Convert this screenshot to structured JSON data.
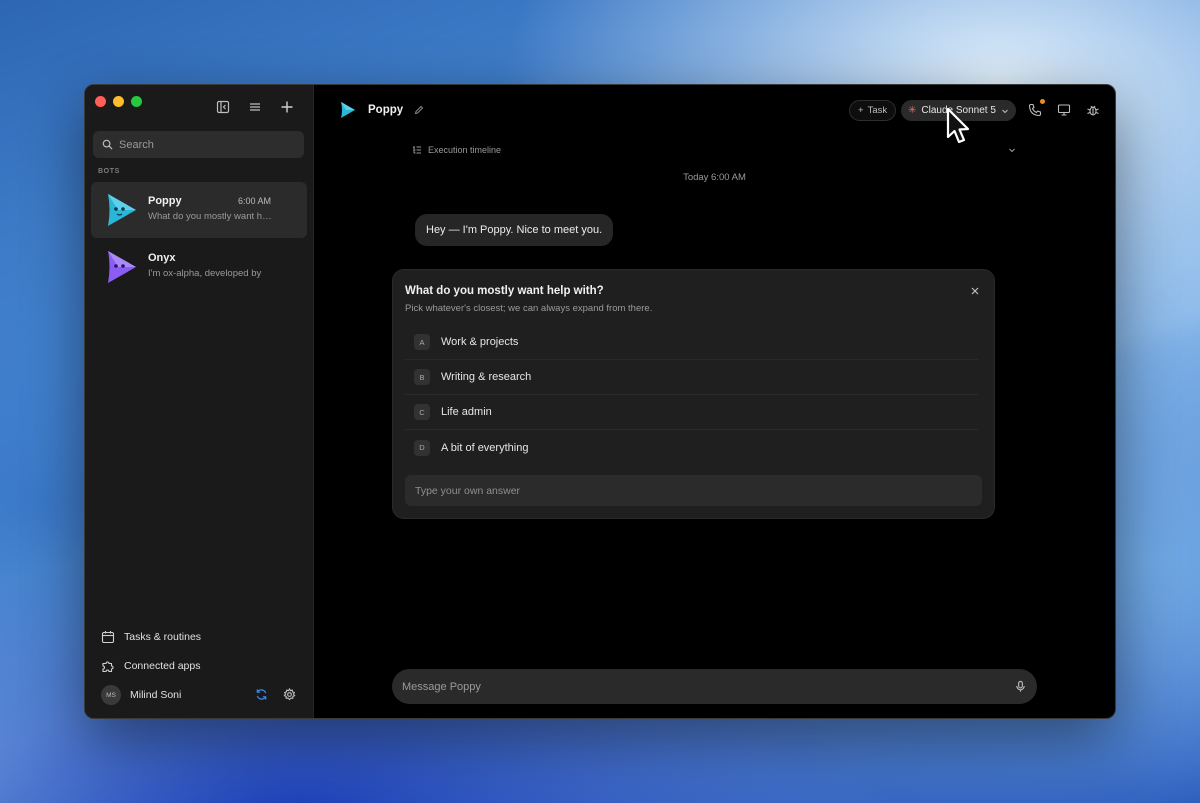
{
  "window": {
    "traffic_lights": [
      "close",
      "minimize",
      "zoom"
    ]
  },
  "sidebar": {
    "search_placeholder": "Search",
    "section_label": "BOTS",
    "bots": [
      {
        "name": "Poppy",
        "time": "6:00 AM",
        "preview": "What do you mostly want help with?",
        "active": true,
        "color": "#2bb5d6"
      },
      {
        "name": "Onyx",
        "time": "",
        "preview": "I'm ox-alpha, developed by",
        "active": false,
        "color": "#8b5cf6"
      }
    ],
    "links": [
      {
        "label": "Tasks & routines",
        "icon": "calendar-icon"
      },
      {
        "label": "Connected apps",
        "icon": "puzzle-icon"
      }
    ],
    "user": {
      "initials": "MS",
      "name": "Milind Soni"
    }
  },
  "header": {
    "title": "Poppy",
    "task_label": "Task",
    "model_label": "Claude Sonnet 5",
    "accent": "#d97757"
  },
  "chat": {
    "timeline_label": "Execution timeline",
    "date_label": "Today 6:00 AM",
    "bot_message": "Hey — I'm Poppy. Nice to meet you."
  },
  "question_card": {
    "title": "What do you mostly want help with?",
    "subtitle": "Pick whatever's closest; we can always expand from there.",
    "options": [
      {
        "key": "A",
        "label": "Work & projects"
      },
      {
        "key": "B",
        "label": "Writing & research"
      },
      {
        "key": "C",
        "label": "Life admin"
      },
      {
        "key": "D",
        "label": "A bit of everything"
      }
    ],
    "own_answer_placeholder": "Type your own answer"
  },
  "composer": {
    "placeholder": "Message Poppy"
  }
}
